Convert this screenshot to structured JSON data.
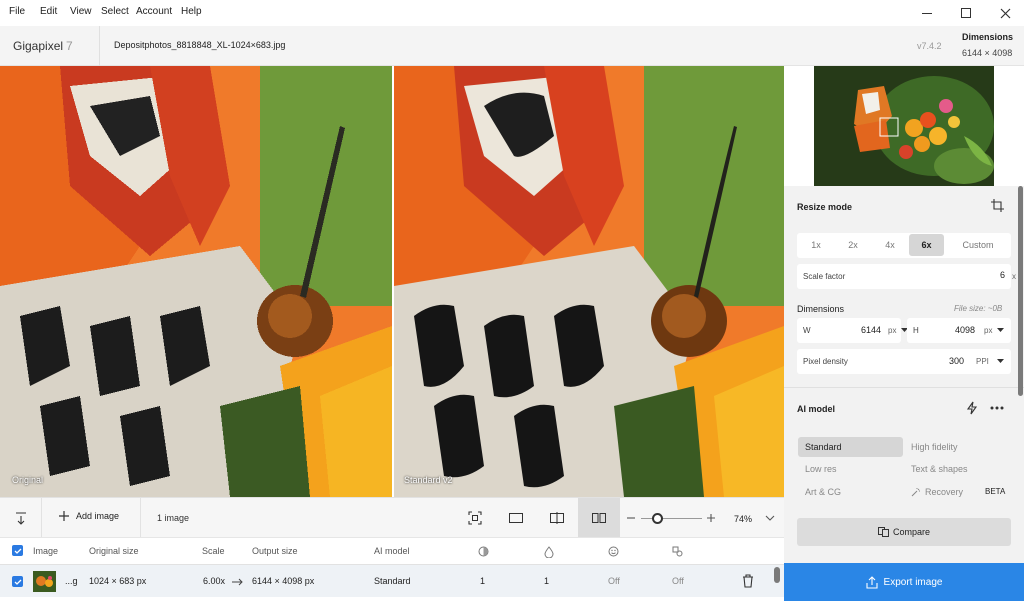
{
  "menu": [
    "File",
    "Edit",
    "View",
    "Select",
    "Account",
    "Help"
  ],
  "app": {
    "name": "Gigapixel",
    "version_major": "7",
    "version": "v7.4.2"
  },
  "file": {
    "name": "Depositphotos_8818848_XL-1024×683.jpg"
  },
  "dimensions": {
    "label": "Dimensions",
    "value": "6144 × 4098"
  },
  "compare_labels": {
    "left": "Original",
    "right": "Standard v2"
  },
  "toolbar": {
    "add_image": "Add image",
    "image_count": "1 image",
    "zoom": "74%",
    "zoom_level": 0.74
  },
  "table": {
    "headers": {
      "image": "Image",
      "original_size": "Original size",
      "scale": "Scale",
      "output_size": "Output size",
      "ai_model": "AI model"
    },
    "rows": [
      {
        "name": "...g",
        "original_size": "1024 × 683 px",
        "scale": "6.00x",
        "output_size": "6144 × 4098 px",
        "ai_model": "Standard",
        "col1": "1",
        "col2": "1",
        "col3": "Off",
        "col4": "Off"
      }
    ]
  },
  "panel": {
    "resize_mode": "Resize mode",
    "scale_options": [
      "1x",
      "2x",
      "4x",
      "6x",
      "Custom"
    ],
    "scale_selected": "6x",
    "scale_factor_label": "Scale factor",
    "scale_factor_value": "6",
    "scale_factor_unit": "x",
    "dimensions_label": "Dimensions",
    "file_size": "File size: ~0B",
    "w_label": "W",
    "w_value": "6144",
    "w_unit": "px",
    "h_label": "H",
    "h_value": "4098",
    "h_unit": "px",
    "pixel_density_label": "Pixel density",
    "pixel_density_value": "300",
    "pixel_density_unit": "PPI",
    "ai_model_label": "AI model",
    "models": [
      "Standard",
      "High fidelity",
      "Low res",
      "Text & shapes",
      "Art & CG",
      "Recovery"
    ],
    "model_selected": "Standard",
    "beta": "BETA",
    "compare": "Compare",
    "export": "Export image"
  },
  "colors": {
    "accent": "#2a86e6",
    "selected_seg": "#d6d6d6",
    "panel_bg": "#f2f2f2"
  }
}
